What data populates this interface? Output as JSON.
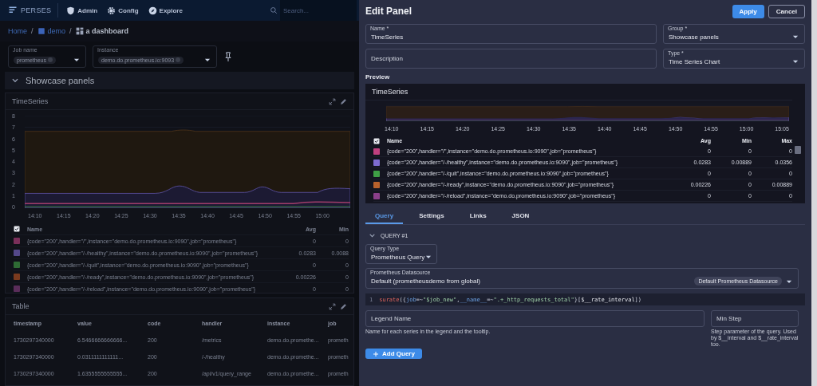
{
  "nav": {
    "brand": "PERSES",
    "items": [
      {
        "label": "Admin"
      },
      {
        "label": "Config"
      },
      {
        "label": "Explore"
      }
    ],
    "search": {
      "placeholder": "Search..."
    }
  },
  "breadcrumb": [
    {
      "kind": "link",
      "label": "Home"
    },
    {
      "kind": "separator",
      "label": "/"
    },
    {
      "kind": "project",
      "label": "demo"
    },
    {
      "kind": "separator",
      "label": "/"
    },
    {
      "kind": "dashboard",
      "label": "a dashboard"
    }
  ],
  "variables": [
    {
      "label": "Job name",
      "value": "prometheus"
    },
    {
      "label": "Instance",
      "value": "demo.do.prometheus.io:9093"
    }
  ],
  "group": {
    "title": "Showcase panels",
    "expanded": true
  },
  "timeseries_panel": {
    "title": "TimeSeries",
    "y_ticks": [
      "8",
      "7",
      "6",
      "5",
      "4",
      "3",
      "2",
      "1",
      "0"
    ],
    "x_ticks": [
      "14:10",
      "14:15",
      "14:20",
      "14:25",
      "14:30",
      "14:35",
      "14:40",
      "14:45",
      "14:50",
      "14:55",
      "15:00"
    ],
    "legend": {
      "all_checked": true,
      "columns": [
        "Name",
        "Avg",
        "Min"
      ],
      "rows": [
        {
          "color": "#7a2f5a",
          "name": "{code=\"200\",handler=\"/\",instance=\"demo.do.prometheus.io:9090\",job=\"prometheus\"}",
          "values": [
            "0",
            "0"
          ]
        },
        {
          "color": "#54488a",
          "name": "{code=\"200\",handler=\"/-/healthy\",instance=\"demo.do.prometheus.io:9090\",job=\"prometheus\"}",
          "values": [
            "0.0283",
            "0.0088"
          ]
        },
        {
          "color": "#2e6b34",
          "name": "{code=\"200\",handler=\"/-/quit\",instance=\"demo.do.prometheus.io:9090\",job=\"prometheus\"}",
          "values": [
            "0",
            "0"
          ]
        },
        {
          "color": "#7a3a1e",
          "name": "{code=\"200\",handler=\"/-/ready\",instance=\"demo.do.prometheus.io:9090\",job=\"prometheus\"}",
          "values": [
            "0.00226",
            "0"
          ]
        },
        {
          "color": "#5a2d5a",
          "name": "{code=\"200\",handler=\"/-/reload\",instance=\"demo.do.prometheus.io:9090\",job=\"prometheus\"}",
          "values": [
            "0",
            "0"
          ]
        }
      ]
    }
  },
  "table_panel": {
    "title": "Table",
    "columns": [
      "timestamp",
      "value",
      "code",
      "handler",
      "instance",
      "job"
    ],
    "rows": [
      [
        "1730297340000",
        "6.5466666666666...",
        "200",
        "/metrics",
        "demo.do.promethe...",
        "prometh"
      ],
      [
        "1730297340000",
        "0.0311111111111...",
        "200",
        "/-/healthy",
        "demo.do.promethe...",
        "prometh"
      ],
      [
        "1730297340000",
        "1.6355555555555...",
        "200",
        "/api/v1/query_range",
        "demo.do.promethe...",
        "prometh"
      ]
    ]
  },
  "edit_panel": {
    "title": "Edit Panel",
    "actions": [
      {
        "label": "Apply",
        "kind": "primary"
      },
      {
        "label": "Cancel",
        "kind": "outlined"
      }
    ],
    "name_field": {
      "label": "Name *",
      "value": "TimeSeries"
    },
    "group_field": {
      "label": "Group *",
      "value": "Showcase panels"
    },
    "description_field": {
      "placeholder": "Description"
    },
    "type_field": {
      "label": "Type *",
      "value": "Time Series Chart"
    },
    "preview": {
      "heading": "Preview",
      "title": "TimeSeries",
      "x_ticks": [
        "14:10",
        "14:15",
        "14:20",
        "14:25",
        "14:30",
        "14:35",
        "14:40",
        "14:45",
        "14:50",
        "14:55",
        "15:00",
        "15:05"
      ],
      "legend": {
        "all_checked": true,
        "columns": [
          "Name",
          "Avg",
          "Min",
          "Max"
        ],
        "rows": [
          {
            "color": "#c0407f",
            "name": "{code=\"200\",handler=\"/\",instance=\"demo.do.prometheus.io:9090\",job=\"prometheus\"}",
            "values": [
              "0",
              "0",
              "0"
            ]
          },
          {
            "color": "#7d6bd0",
            "name": "{code=\"200\",handler=\"/-/healthy\",instance=\"demo.do.prometheus.io:9090\",job=\"prometheus\"}",
            "values": [
              "0.0283",
              "0.00889",
              "0.0356"
            ]
          },
          {
            "color": "#3f9f46",
            "name": "{code=\"200\",handler=\"/-/quit\",instance=\"demo.do.prometheus.io:9090\",job=\"prometheus\"}",
            "values": [
              "0",
              "0",
              "0"
            ]
          },
          {
            "color": "#b8612c",
            "name": "{code=\"200\",handler=\"/-/ready\",instance=\"demo.do.prometheus.io:9090\",job=\"prometheus\"}",
            "values": [
              "0.00226",
              "0",
              "0.00889"
            ]
          },
          {
            "color": "#8a3f8a",
            "name": "{code=\"200\",handler=\"/-/reload\",instance=\"demo.do.prometheus.io:9090\",job=\"prometheus\"}",
            "values": [
              "0",
              "0",
              "0"
            ]
          }
        ]
      }
    },
    "tabs": [
      {
        "label": "Query",
        "selected": true
      },
      {
        "label": "Settings",
        "selected": false
      },
      {
        "label": "Links",
        "selected": false
      },
      {
        "label": "JSON",
        "selected": false
      }
    ],
    "query": {
      "title": "QUERY #1",
      "expanded": true,
      "query_type": {
        "label": "Query Type",
        "value": "Prometheus Query"
      },
      "datasource": {
        "label": "Prometheus Datasource",
        "value": "Default (prometheusdemo from global)",
        "chip": "Default Prometheus Datasource"
      },
      "editor": {
        "line_number": "1",
        "tokens": [
          {
            "kind": "fn",
            "text": "surate"
          },
          {
            "kind": "punc",
            "text": "({"
          },
          {
            "kind": "label",
            "text": "job"
          },
          {
            "kind": "op",
            "text": "=~"
          },
          {
            "kind": "string",
            "text": "\"$job_new\""
          },
          {
            "kind": "punc",
            "text": ","
          },
          {
            "kind": "label",
            "text": "__name__"
          },
          {
            "kind": "op",
            "text": "=~"
          },
          {
            "kind": "string",
            "text": "\".+_http_requests_total\""
          },
          {
            "kind": "punc",
            "text": "}["
          },
          {
            "kind": "var",
            "text": "$__rate_interval"
          },
          {
            "kind": "punc",
            "text": "])"
          }
        ]
      },
      "legend_name": {
        "placeholder": "Legend Name",
        "help": "Name for each series in the legend and the tooltip."
      },
      "min_step": {
        "placeholder": "Min Step",
        "help": "Step parameter of the query. Used by $__interval and $__rate_interval too."
      }
    },
    "add_query": {
      "label": "Add Query"
    }
  }
}
